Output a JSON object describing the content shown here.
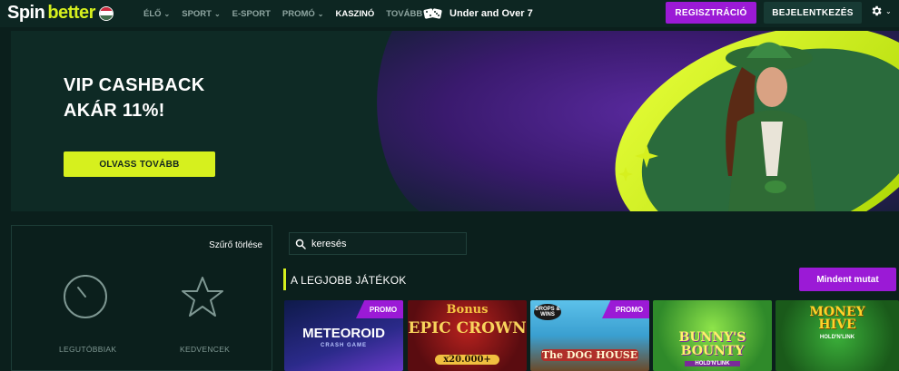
{
  "header": {
    "logo_spin": "Spin",
    "logo_better": "better",
    "nav": [
      {
        "label": "ÉLŐ",
        "has_menu": true
      },
      {
        "label": "SPORT",
        "has_menu": true
      },
      {
        "label": "E-SPORT",
        "has_menu": false
      },
      {
        "label": "PROMÓ",
        "has_menu": true
      },
      {
        "label": "KASZINÓ",
        "has_menu": false
      },
      {
        "label": "TOVÁBB",
        "has_menu": true
      }
    ],
    "promo_link": "Under and Over 7",
    "register": "REGISZTRÁCIÓ",
    "login": "BEJELENTKEZÉS"
  },
  "banner": {
    "title_line1": "VIP CASHBACK",
    "title_line2": "AKÁR 11%!",
    "button": "OLVASS TOVÁBB"
  },
  "filters": {
    "clear": "Szűrő törlése",
    "recent": "LEGUTÓBBIAK",
    "favorites": "KEDVENCEK"
  },
  "search": {
    "value": "keresés"
  },
  "section": {
    "title": "A LEGJOBB JÁTÉKOK",
    "show_all": "Mindent mutat"
  },
  "games": [
    {
      "name": "METEOROID",
      "sub": "CRASH GAME",
      "badge": "PROMO"
    },
    {
      "name": "EPIC CROWN",
      "sub": "x20.000+",
      "top": "Bonus",
      "badge": ""
    },
    {
      "name": "The DOG HOUSE",
      "sub": "DROPS & WINS",
      "badge": "PROMO"
    },
    {
      "name": "BUNNY'S BOUNTY",
      "sub": "HOLD'N'LINK",
      "badge": ""
    },
    {
      "name": "MONEY HIVE",
      "sub": "HOLD'N'LINK",
      "badge": ""
    }
  ],
  "colors": {
    "accent_lime": "#d6f01e",
    "accent_purple": "#9b1ad6",
    "background": "#0b1f1c"
  }
}
